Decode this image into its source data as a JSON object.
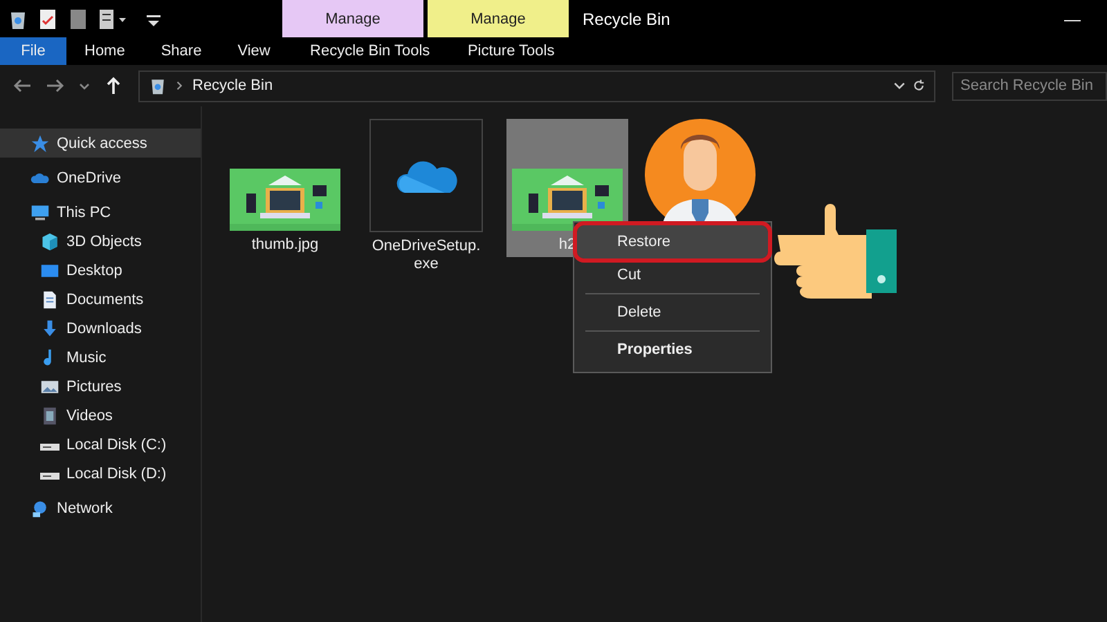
{
  "window": {
    "title": "Recycle Bin",
    "minimize": "—"
  },
  "contextual_tabs": [
    {
      "label": "Manage",
      "color": "#e6c8f5"
    },
    {
      "label": "Manage",
      "color": "#f0ef8a"
    }
  ],
  "tabs": [
    {
      "label": "File",
      "selected": true
    },
    {
      "label": "Home",
      "selected": false
    },
    {
      "label": "Share",
      "selected": false
    },
    {
      "label": "View",
      "selected": false
    },
    {
      "label": "Recycle Bin Tools",
      "selected": false
    },
    {
      "label": "Picture Tools",
      "selected": false
    }
  ],
  "address": {
    "path": "Recycle Bin"
  },
  "search": {
    "placeholder": "Search Recycle Bin"
  },
  "sidebar": {
    "items": [
      {
        "label": "Quick access",
        "selected": true
      },
      {
        "label": "OneDrive",
        "selected": false
      },
      {
        "label": "This PC",
        "selected": false,
        "children": [
          {
            "label": "3D Objects",
            "selected": false
          },
          {
            "label": "Desktop",
            "selected": false
          },
          {
            "label": "Documents",
            "selected": false
          },
          {
            "label": "Downloads",
            "selected": false
          },
          {
            "label": "Music",
            "selected": false
          },
          {
            "label": "Pictures",
            "selected": false
          },
          {
            "label": "Videos",
            "selected": false
          },
          {
            "label": "Local Disk (C:)",
            "selected": false
          },
          {
            "label": "Local Disk (D:)",
            "selected": false
          }
        ]
      },
      {
        "label": "Network",
        "selected": false
      }
    ]
  },
  "files": [
    {
      "name": "thumb.jpg",
      "kind": "picture",
      "selected": false
    },
    {
      "name": "OneDriveSetup.exe",
      "kind": "onedrive",
      "selected": false
    },
    {
      "name": "h2",
      "kind": "picture",
      "selected": true
    }
  ],
  "context_menu": {
    "items": [
      {
        "kind": "item",
        "label": "Restore",
        "selected": true,
        "bold": false
      },
      {
        "kind": "item",
        "label": "Cut",
        "selected": false,
        "bold": false
      },
      {
        "kind": "separator"
      },
      {
        "kind": "item",
        "label": "Delete",
        "selected": false,
        "bold": false
      },
      {
        "kind": "separator"
      },
      {
        "kind": "item",
        "label": "Properties",
        "selected": false,
        "bold": true
      }
    ]
  }
}
